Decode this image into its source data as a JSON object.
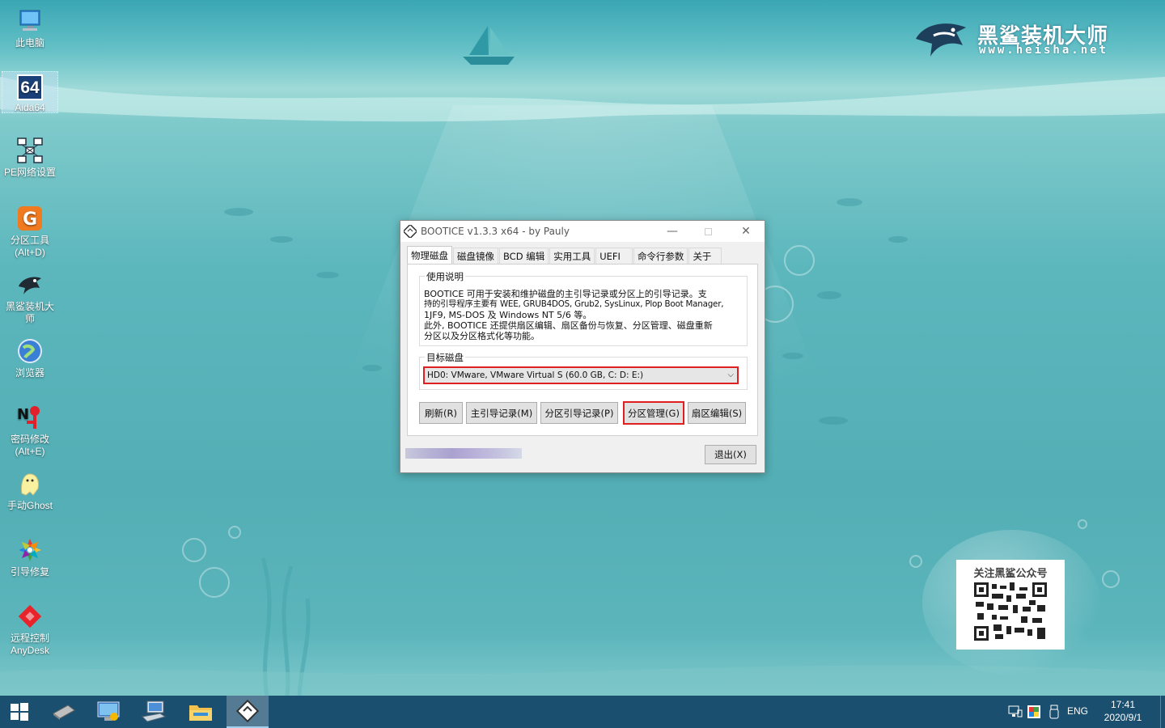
{
  "desktop": {
    "icons": [
      {
        "label": "此电脑",
        "icon": "computer-icon"
      },
      {
        "label": "Aida64",
        "icon": "aida64-icon"
      },
      {
        "label": "PE网络设置",
        "icon": "network-icon"
      },
      {
        "label": "分区工具\n(Alt+D)",
        "icon": "partition-tool-icon"
      },
      {
        "label": "黑鲨装机大\n师",
        "icon": "shark-icon"
      },
      {
        "label": "浏览器",
        "icon": "browser-icon"
      },
      {
        "label": "密码修改\n(Alt+E)",
        "icon": "password-icon"
      },
      {
        "label": "手动Ghost",
        "icon": "ghost-icon"
      },
      {
        "label": "引导修复",
        "icon": "boot-repair-icon"
      },
      {
        "label": "远程控制\nAnyDesk",
        "icon": "anydesk-icon"
      }
    ],
    "aida_badge": "64",
    "brand": {
      "title": "黑鲨装机大师",
      "url": "www.heisha.net"
    },
    "qr_caption": "关注黑鲨公众号"
  },
  "dialog": {
    "title": "BOOTICE v1.3.3 x64 - by Pauly",
    "tabs": [
      "物理磁盘",
      "磁盘镜像",
      "BCD 编辑",
      "实用工具",
      "UEFI",
      "命令行参数",
      "关于"
    ],
    "active_tab": "物理磁盘",
    "usage": {
      "label": "使用说明",
      "lines": [
        "BOOTICE 可用于安装和维护磁盘的主引导记录或分区上的引导记录。支",
        "持的引导程序主要有 WEE, GRUB4DOS, Grub2, SysLinux, Plop Boot Manager,",
        "1JF9, MS-DOS 及 Windows NT 5/6 等。",
        "此外, BOOTICE 还提供扇区编辑、扇区备份与恢复、分区管理、磁盘重新",
        "分区以及分区格式化等功能。"
      ]
    },
    "target_disk": {
      "label": "目标磁盘",
      "value": "HD0: VMware, VMware Virtual S (60.0 GB, C: D: E:)"
    },
    "buttons": {
      "refresh": "刷新(R)",
      "mbr": "主引导记录(M)",
      "pbr": "分区引导记录(P)",
      "parts_manage": "分区管理(G)",
      "sector_edit": "扇区编辑(S)",
      "exit": "退出(X)"
    },
    "progress": 1.0,
    "accent_color": "#e02020"
  },
  "taskbar": {
    "language": "ENG",
    "time": "17:41",
    "date": "2020/9/1"
  }
}
